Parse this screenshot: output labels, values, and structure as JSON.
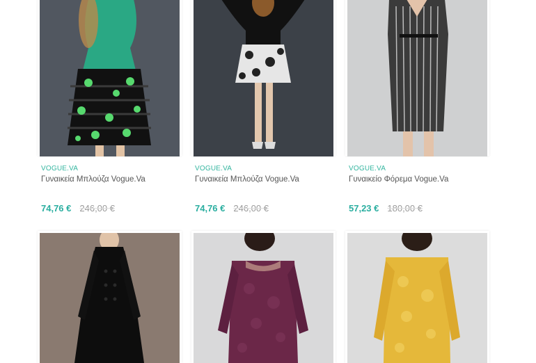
{
  "products": [
    {
      "brand": "VOGUE.VA",
      "title": "Γυναικεία Μπλούζα Vogue.Va",
      "price": "74,76 €",
      "old_price": "246,00 €",
      "image": "green-sweater-striped-skirt"
    },
    {
      "brand": "VOGUE.VA",
      "title": "Γυναικεία Μπλούζα Vogue.Va",
      "price": "74,76 €",
      "old_price": "246,00 €",
      "image": "black-top-floral-skirt"
    },
    {
      "brand": "VOGUE.VA",
      "title": "Γυναικείο Φόρεμα Vogue.Va",
      "price": "57,23 €",
      "old_price": "180,00 €",
      "image": "striped-wrap-dress"
    },
    {
      "image": "black-double-breasted-coat"
    },
    {
      "image": "burgundy-lace-dress"
    },
    {
      "image": "yellow-lace-dress"
    }
  ]
}
